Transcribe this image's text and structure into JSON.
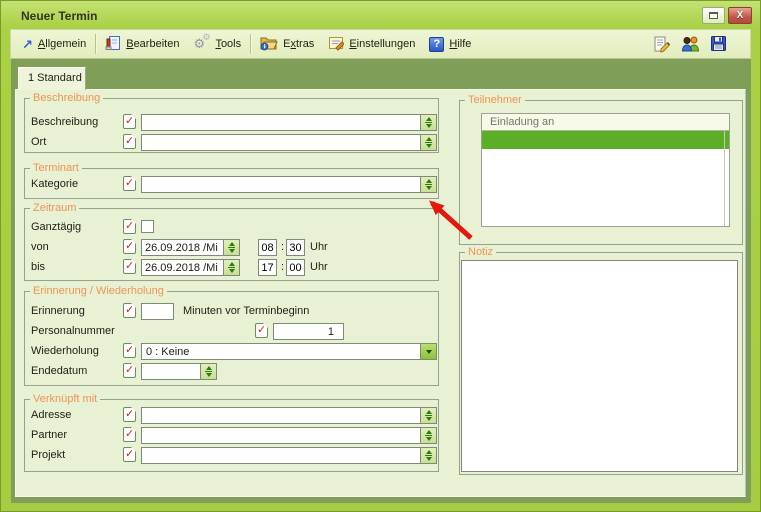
{
  "window": {
    "title": "Neuer Termin"
  },
  "icons": {
    "allgemein_arrow": "↗",
    "tools_gear": "⚙",
    "hilfe_glyph": "?",
    "close_glyph": "X"
  },
  "toolbar": {
    "items": [
      {
        "pre": "",
        "key": "A",
        "post": "llgemein"
      },
      {
        "pre": "",
        "key": "B",
        "post": "earbeiten"
      },
      {
        "pre": "",
        "key": "T",
        "post": "ools"
      },
      {
        "pre": "E",
        "key": "x",
        "post": "tras"
      },
      {
        "pre": "",
        "key": "E",
        "post": "instellungen"
      },
      {
        "pre": "",
        "key": "H",
        "post": "ilfe"
      }
    ]
  },
  "tab": {
    "label": "1 Standard"
  },
  "form": {
    "beschreibung": {
      "legend": "Beschreibung",
      "rows": [
        {
          "label": "Beschreibung",
          "value": ""
        },
        {
          "label": "Ort",
          "value": ""
        }
      ]
    },
    "terminart": {
      "legend": "Terminart",
      "rows": [
        {
          "label": "Kategorie",
          "value": ""
        }
      ]
    },
    "zeitraum": {
      "legend": "Zeitraum",
      "allday_label": "Ganztägig",
      "colon": ":",
      "von": {
        "label": "von",
        "date": "26.09.2018 /Mi",
        "hour": "08",
        "minute": "30",
        "unit": "Uhr"
      },
      "bis": {
        "label": "bis",
        "date": "26.09.2018 /Mi",
        "hour": "17",
        "minute": "00",
        "unit": "Uhr"
      }
    },
    "erinnerung": {
      "legend": "Erinnerung / Wiederholung",
      "reminder_label": "Erinnerung",
      "reminder_value": "",
      "reminder_suffix": "Minuten vor Terminbeginn",
      "personalnummer_label": "Personalnummer",
      "personalnummer_value": "1",
      "wiederholung_label": "Wiederholung",
      "wiederholung_value": "0 : Keine",
      "endedatum_label": "Endedatum",
      "endedatum_value": ""
    },
    "verknuepft": {
      "legend": "Verknüpft mit",
      "rows": [
        {
          "label": "Adresse",
          "value": ""
        },
        {
          "label": "Partner",
          "value": ""
        },
        {
          "label": "Projekt",
          "value": ""
        }
      ]
    },
    "teilnehmer": {
      "legend": "Teilnehmer",
      "list_header": "Einladung an"
    },
    "notiz": {
      "legend": "Notiz",
      "value": ""
    }
  },
  "colors": {
    "frame_lime": "#aad145",
    "panel_green": "#e9f1d5",
    "legend_orange": "#ee9450",
    "selected_row_green": "#5cae27",
    "arrow_red": "#e3170d"
  }
}
